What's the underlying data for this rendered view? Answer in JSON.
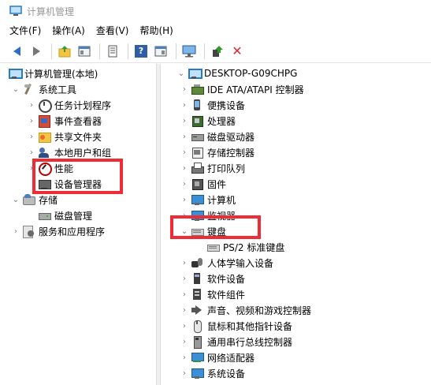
{
  "window": {
    "title": "计算机管理"
  },
  "menu": [
    "文件(F)",
    "操作(A)",
    "查看(V)",
    "帮助(H)"
  ],
  "toolbar": {
    "buttons": [
      "back-arrow-icon",
      "forward-arrow-icon",
      "up-folder-icon",
      "console-tree-icon",
      "properties-icon",
      "help-icon",
      "show-hide-icon",
      "monitor-icon",
      "update-driver-icon",
      "uninstall-icon"
    ]
  },
  "left_tree": {
    "root": "计算机管理(本地)",
    "system_tools": "系统工具",
    "task_scheduler": "任务计划程序",
    "event_viewer": "事件查看器",
    "shared_folders": "共享文件夹",
    "local_users": "本地用户和组",
    "performance": "性能",
    "device_manager": "设备管理器",
    "storage": "存储",
    "disk_management": "磁盘管理",
    "services": "服务和应用程序"
  },
  "device_tree": {
    "root": "DESKTOP-G09CHPG",
    "categories": [
      {
        "label": "IDE ATA/ATAPI 控制器",
        "icon": "ide-controller-icon"
      },
      {
        "label": "便携设备",
        "icon": "portable-device-icon"
      },
      {
        "label": "处理器",
        "icon": "processor-icon"
      },
      {
        "label": "磁盘驱动器",
        "icon": "disk-drive-icon"
      },
      {
        "label": "存储控制器",
        "icon": "storage-controller-icon"
      },
      {
        "label": "打印队列",
        "icon": "print-queue-icon"
      },
      {
        "label": "固件",
        "icon": "firmware-icon"
      },
      {
        "label": "计算机",
        "icon": "computer-icon"
      },
      {
        "label": "监视器",
        "icon": "monitor-icon"
      },
      {
        "label": "键盘",
        "icon": "keyboard-icon"
      },
      {
        "label": "PS/2 标准键盘",
        "icon": "keyboard-icon"
      },
      {
        "label": "人体学输入设备",
        "icon": "hid-icon"
      },
      {
        "label": "软件设备",
        "icon": "software-device-icon"
      },
      {
        "label": "软件组件",
        "icon": "software-component-icon"
      },
      {
        "label": "声音、视频和游戏控制器",
        "icon": "sound-icon"
      },
      {
        "label": "鼠标和其他指针设备",
        "icon": "mouse-icon"
      },
      {
        "label": "通用串行总线控制器",
        "icon": "usb-icon"
      },
      {
        "label": "网络适配器",
        "icon": "network-adapter-icon"
      },
      {
        "label": "系统设备",
        "icon": "system-device-icon"
      }
    ]
  },
  "colors": {
    "highlight": "#ef2b35",
    "accent": "#2c6fc4"
  }
}
